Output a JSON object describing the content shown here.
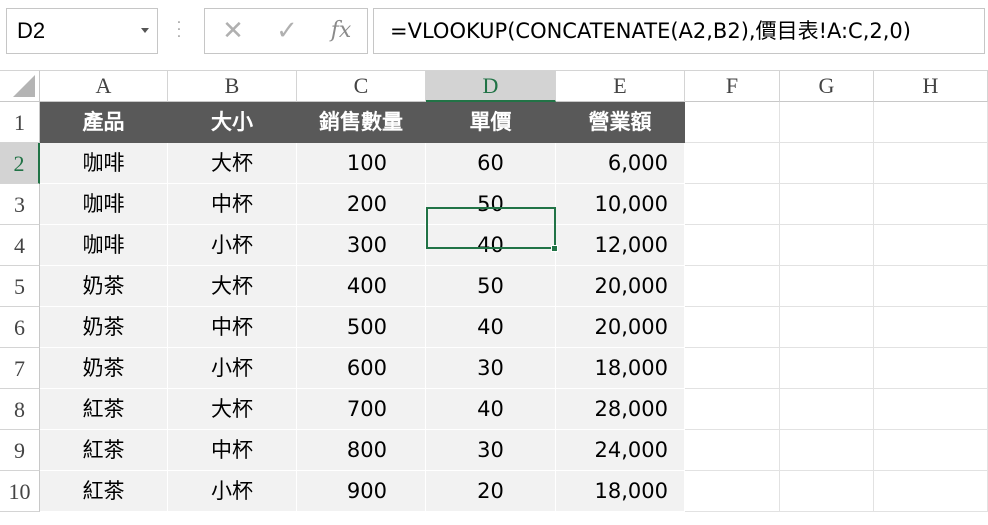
{
  "name_box": {
    "value": "D2"
  },
  "formula_bar": {
    "cancel_icon": "✕",
    "confirm_icon": "✓",
    "fx_icon": "fx",
    "formula": "=VLOOKUP(CONCATENATE(A2,B2),價目表!A:C,2,0)"
  },
  "columns": [
    "A",
    "B",
    "C",
    "D",
    "E",
    "F",
    "G",
    "H"
  ],
  "rows": [
    "1",
    "2",
    "3",
    "4",
    "5",
    "6",
    "7",
    "8",
    "9",
    "10"
  ],
  "active_cell": "D2",
  "table": {
    "headers": [
      "產品",
      "大小",
      "銷售數量",
      "單價",
      "營業額"
    ],
    "rows": [
      [
        "咖啡",
        "大杯",
        "100",
        "60",
        "6,000"
      ],
      [
        "咖啡",
        "中杯",
        "200",
        "50",
        "10,000"
      ],
      [
        "咖啡",
        "小杯",
        "300",
        "40",
        "12,000"
      ],
      [
        "奶茶",
        "大杯",
        "400",
        "50",
        "20,000"
      ],
      [
        "奶茶",
        "中杯",
        "500",
        "40",
        "20,000"
      ],
      [
        "奶茶",
        "小杯",
        "600",
        "30",
        "18,000"
      ],
      [
        "紅茶",
        "大杯",
        "700",
        "40",
        "28,000"
      ],
      [
        "紅茶",
        "中杯",
        "800",
        "30",
        "24,000"
      ],
      [
        "紅茶",
        "小杯",
        "900",
        "20",
        "18,000"
      ]
    ]
  },
  "colors": {
    "header_fill": "#595959",
    "body_fill": "#f2f2f2",
    "selection": "#217346"
  }
}
